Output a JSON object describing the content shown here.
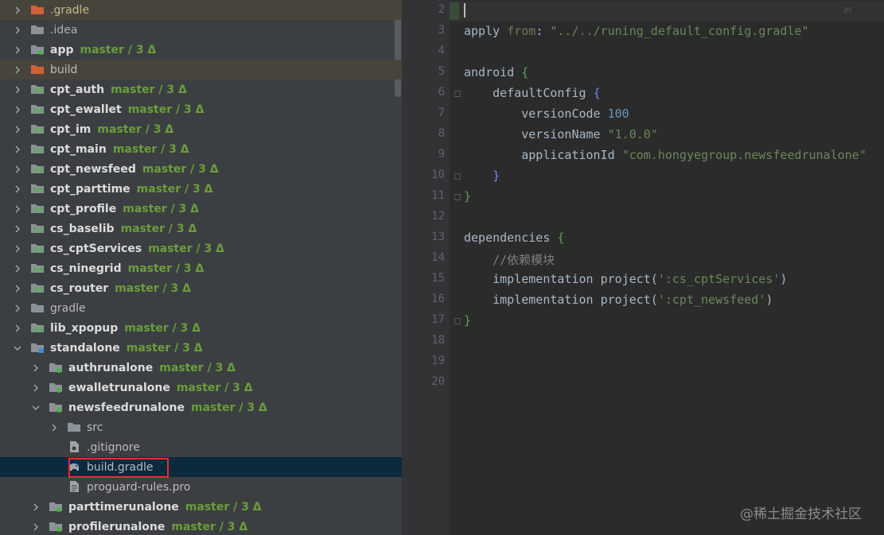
{
  "tree": {
    "items": [
      {
        "name": ".gradle",
        "vcs": "",
        "style": "orange"
      },
      {
        "name": ".idea",
        "vcs": "",
        "style": "dim"
      },
      {
        "name": "app",
        "vcs": "master / 3 Δ",
        "style": "module"
      },
      {
        "name": "build",
        "vcs": "",
        "style": "plain"
      },
      {
        "name": "cpt_auth",
        "vcs": "master / 3 Δ",
        "style": "module"
      },
      {
        "name": "cpt_ewallet",
        "vcs": "master / 3 Δ",
        "style": "module"
      },
      {
        "name": "cpt_im",
        "vcs": "master / 3 Δ",
        "style": "module"
      },
      {
        "name": "cpt_main",
        "vcs": "master / 3 Δ",
        "style": "module"
      },
      {
        "name": "cpt_newsfeed",
        "vcs": "master / 3 Δ",
        "style": "module"
      },
      {
        "name": "cpt_parttime",
        "vcs": "master / 3 Δ",
        "style": "module"
      },
      {
        "name": "cpt_profile",
        "vcs": "master / 3 Δ",
        "style": "module"
      },
      {
        "name": "cs_baselib",
        "vcs": "master / 3 Δ",
        "style": "module"
      },
      {
        "name": "cs_cptServices",
        "vcs": "master / 3 Δ",
        "style": "module"
      },
      {
        "name": "cs_ninegrid",
        "vcs": "master / 3 Δ",
        "style": "module"
      },
      {
        "name": "cs_router",
        "vcs": "master / 3 Δ",
        "style": "module"
      },
      {
        "name": "gradle",
        "vcs": "",
        "style": "plain"
      },
      {
        "name": "lib_xpopup",
        "vcs": "master / 3 Δ",
        "style": "module"
      },
      {
        "name": "standalone",
        "vcs": "master / 3 Δ",
        "style": "module"
      },
      {
        "name": "authrunalone",
        "vcs": "master / 3 Δ",
        "style": "module"
      },
      {
        "name": "ewalletrunalone",
        "vcs": "master / 3 Δ",
        "style": "module"
      },
      {
        "name": "newsfeedrunalone",
        "vcs": "master / 3 Δ",
        "style": "module"
      },
      {
        "name": "src",
        "vcs": "",
        "style": "plain"
      },
      {
        "name": ".gitignore",
        "vcs": "",
        "style": "plain"
      },
      {
        "name": "build.gradle",
        "vcs": "",
        "style": "plain"
      },
      {
        "name": "proguard-rules.pro",
        "vcs": "",
        "style": "plain"
      },
      {
        "name": "parttimerunalone",
        "vcs": "master / 3 Δ",
        "style": "module"
      },
      {
        "name": "profilerunalone",
        "vcs": "master / 3 Δ",
        "style": "module"
      }
    ]
  },
  "editor": {
    "line_numbers": [
      "2",
      "3",
      "4",
      "5",
      "6",
      "7",
      "8",
      "9",
      "10",
      "11",
      "12",
      "13",
      "14",
      "15",
      "16",
      "17",
      "18",
      "19",
      "20"
    ],
    "code": {
      "l3_apply": "apply",
      "l3_from": "from",
      "l3_colon": ": ",
      "l3_path": "\"../../runing_default_config.gradle\"",
      "l5_android": "android ",
      "l5_brace": "{",
      "l6_default": "    defaultConfig ",
      "l6_brace": "{",
      "l7_key": "        versionCode ",
      "l7_val": "100",
      "l8_key": "        versionName ",
      "l8_val": "\"1.0.0\"",
      "l9_key": "        applicationId ",
      "l9_val": "\"com.hongyegroup.newsfeedrunalone\"",
      "l10_brace": "    }",
      "l11_brace": "}",
      "l13_deps": "dependencies ",
      "l13_brace": "{",
      "l14_comment": "    //依赖模块",
      "l15_impl": "    implementation project(",
      "l15_arg": "':cs_cptServices'",
      "l15_end": ")",
      "l16_impl": "    implementation project(",
      "l16_arg": "':cpt_newsfeed'",
      "l16_end": ")",
      "l17_brace": "}"
    }
  },
  "watermark": "@稀土掘金技术社区",
  "colors": {
    "vcs_branch": "#6a9e3b",
    "selection": "#0d293e",
    "highlight_border": "#e4302b",
    "string": "#6a8759",
    "number": "#6897bb"
  }
}
